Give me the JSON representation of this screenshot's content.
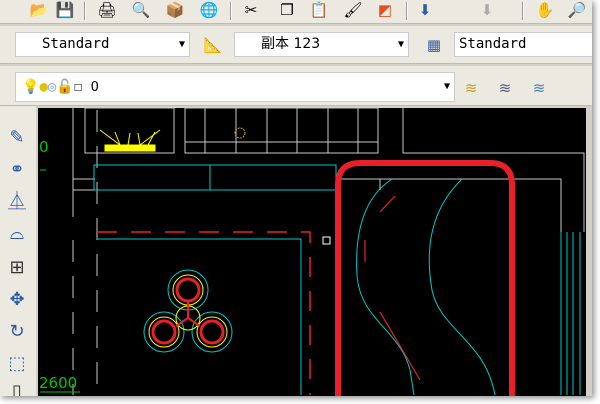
{
  "toolbar_top": {
    "icons": [
      "open-icon",
      "save-icon",
      "print-icon",
      "preview-icon",
      "publish-icon",
      "3d-icon",
      "cut-icon",
      "copy-icon",
      "paste-icon",
      "match-properties-icon",
      "block-icon",
      "undo-icon",
      "redo-icon",
      "pan-icon",
      "zoom-icon"
    ]
  },
  "styles_toolbar": {
    "text_style": "Standard",
    "dim_style": "副本 123",
    "table_style": "Standard"
  },
  "layer_toolbar": {
    "layer_name": "0",
    "icons": [
      "layer-on-icon",
      "layer-freeze-icon",
      "layer-viewport-icon",
      "layer-lock-icon",
      "layer-color-icon"
    ]
  },
  "left_tools": [
    "erase-icon",
    "copy-object-icon",
    "mirror-icon",
    "offset-icon",
    "array-icon",
    "move-icon",
    "rotate-icon",
    "scale-icon",
    "stretch-icon"
  ],
  "drawing": {
    "dim_label_top": "0",
    "dim_label_bottom": "2600"
  },
  "colors": {
    "background": "#000000",
    "cyan": "#00c8c8",
    "red": "#e8202a",
    "white": "#c8c8c8",
    "yellow": "#ffff00",
    "green": "#00c800"
  }
}
